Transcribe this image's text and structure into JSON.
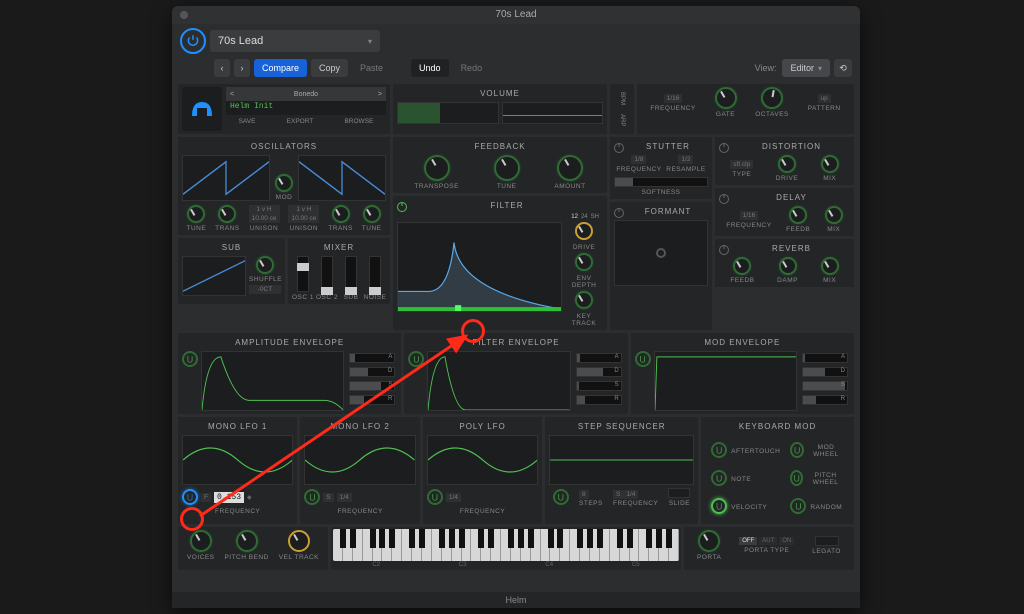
{
  "window_title": "70s Lead",
  "footer": "Helm",
  "toolbar": {
    "preset": "70s Lead",
    "nav_prev": "‹",
    "nav_next": "›",
    "compare": "Compare",
    "copy": "Copy",
    "paste": "Paste",
    "undo": "Undo",
    "redo": "Redo",
    "view_label": "View:",
    "view_value": "Editor"
  },
  "preset": {
    "author": "Bonedo",
    "name": "Helm Init",
    "prev": "<",
    "next": ">",
    "save": "SAVE",
    "export": "EXPORT",
    "browse": "BROWSE"
  },
  "volume": {
    "title": "VOLUME"
  },
  "arp": {
    "bpm": "BPM",
    "arp": "ARP",
    "freq_val": "1/16",
    "pattern_val": "up",
    "knobs": {
      "frequency": "FREQUENCY",
      "gate": "GATE",
      "octaves": "OCTAVES",
      "pattern": "PATTERN"
    }
  },
  "osc": {
    "title": "OSCILLATORS",
    "mod": "MOD",
    "tune": "TUNE",
    "trans": "TRANS",
    "unison": "UNISON",
    "unison_val1": "1 v H",
    "unison_det1": "10.00 ce",
    "unison_val2": "1 v H",
    "unison_det2": "10.00 ce"
  },
  "sub": {
    "title": "SUB",
    "shuffle": "SHUFFLE",
    "oct": "-0CT"
  },
  "mixer": {
    "title": "MIXER",
    "ch": [
      "OSC 1",
      "OSC 2",
      "SUB",
      "NOISE"
    ]
  },
  "feedback": {
    "title": "FEEDBACK",
    "knobs": [
      "TRANSPOSE",
      "TUNE",
      "AMOUNT"
    ]
  },
  "filter": {
    "title": "FILTER",
    "slopes": [
      "12",
      "24"
    ],
    "sh": "SH",
    "drive": "DRIVE",
    "env": "ENV DEPTH",
    "key": "KEY TRACK"
  },
  "stutter": {
    "title": "STUTTER",
    "knobs": [
      "FREQUENCY",
      "RESAMPLE"
    ],
    "soft": "SOFTNESS",
    "v1": "1/8",
    "v2": "1/2"
  },
  "distortion": {
    "title": "DISTORTION",
    "type": "sft clp",
    "knobs": [
      "TYPE",
      "DRIVE",
      "MIX"
    ]
  },
  "delay": {
    "title": "DELAY",
    "v": "1/16",
    "knobs": [
      "FREQUENCY",
      "FEEDB",
      "MIX"
    ]
  },
  "formant": {
    "title": "FORMANT"
  },
  "reverb": {
    "title": "REVERB",
    "knobs": [
      "FEEDB",
      "DAMP",
      "MIX"
    ]
  },
  "env": {
    "amp": "AMPLITUDE ENVELOPE",
    "filt": "FILTER ENVELOPE",
    "mod": "MOD ENVELOPE",
    "adsr": [
      "A",
      "D",
      "S",
      "R"
    ]
  },
  "lfo": {
    "mono1": "MONO LFO 1",
    "mono2": "MONO LFO 2",
    "poly": "POLY LFO",
    "step": "STEP SEQUENCER",
    "freq": "FREQUENCY",
    "val_153": "0.153",
    "f": "F",
    "s": "S",
    "rate2": "1/4",
    "rate3": "1/4",
    "steps": "8",
    "steps_lbl": "STEPS",
    "step_rate": "1/4",
    "slide": "SLIDE"
  },
  "keyboard_mod": {
    "title": "KEYBOARD MOD",
    "items": [
      "AFTERTOUCH",
      "MOD WHEEL",
      "NOTE",
      "PITCH WHEEL",
      "VELOCITY",
      "RANDOM"
    ]
  },
  "bottom": {
    "voices": "VOICES",
    "pitchbend": "PITCH BEND",
    "veltrack": "VEL TRACK",
    "porta": "PORTA",
    "porta_type": "PORTA TYPE",
    "legato": "LEGATO",
    "off": "OFF",
    "aut": "AUT",
    "on": "ON",
    "oct": [
      "C2",
      "C3",
      "C4",
      "C5"
    ]
  }
}
